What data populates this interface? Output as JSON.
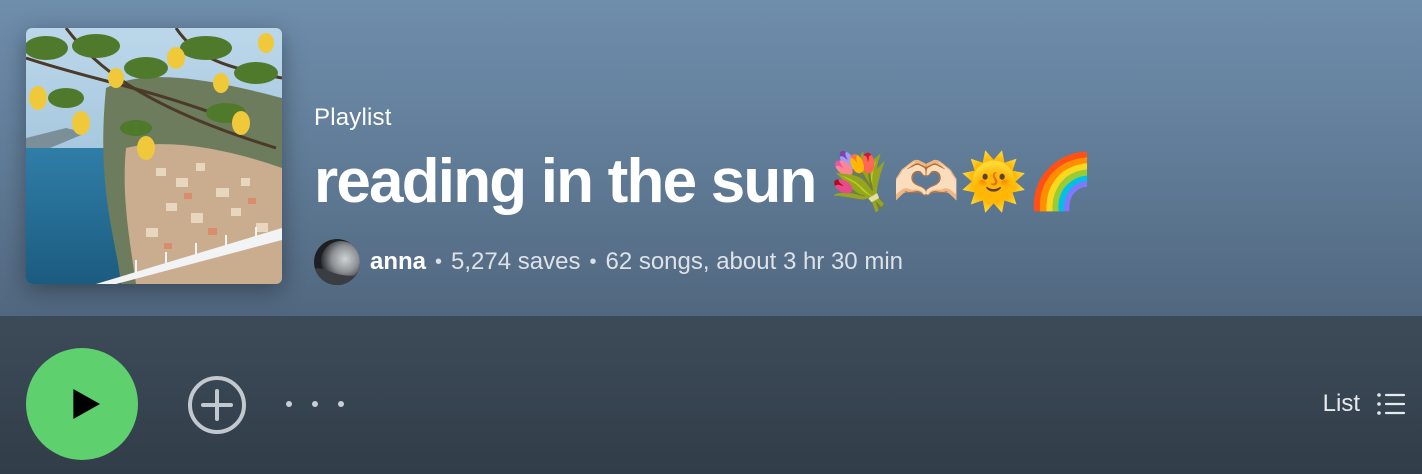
{
  "playlist": {
    "type_label": "Playlist",
    "title": "reading in the sun",
    "title_emojis": "💐🫶🏻🌞🌈",
    "owner": "anna",
    "saves": "5,274 saves",
    "songs_duration": "62 songs, about 3 hr 30 min",
    "separator": "•"
  },
  "actions": {
    "view_label": "List"
  },
  "colors": {
    "header_top": "#6f8eac",
    "header_bottom": "#51677f",
    "actionbar_bg": "#313d49",
    "play_button": "#5fd06e"
  },
  "icons": {
    "play": "play-icon",
    "add": "add-circle-icon",
    "more": "more-horizontal-icon",
    "list_view": "list-view-icon"
  }
}
